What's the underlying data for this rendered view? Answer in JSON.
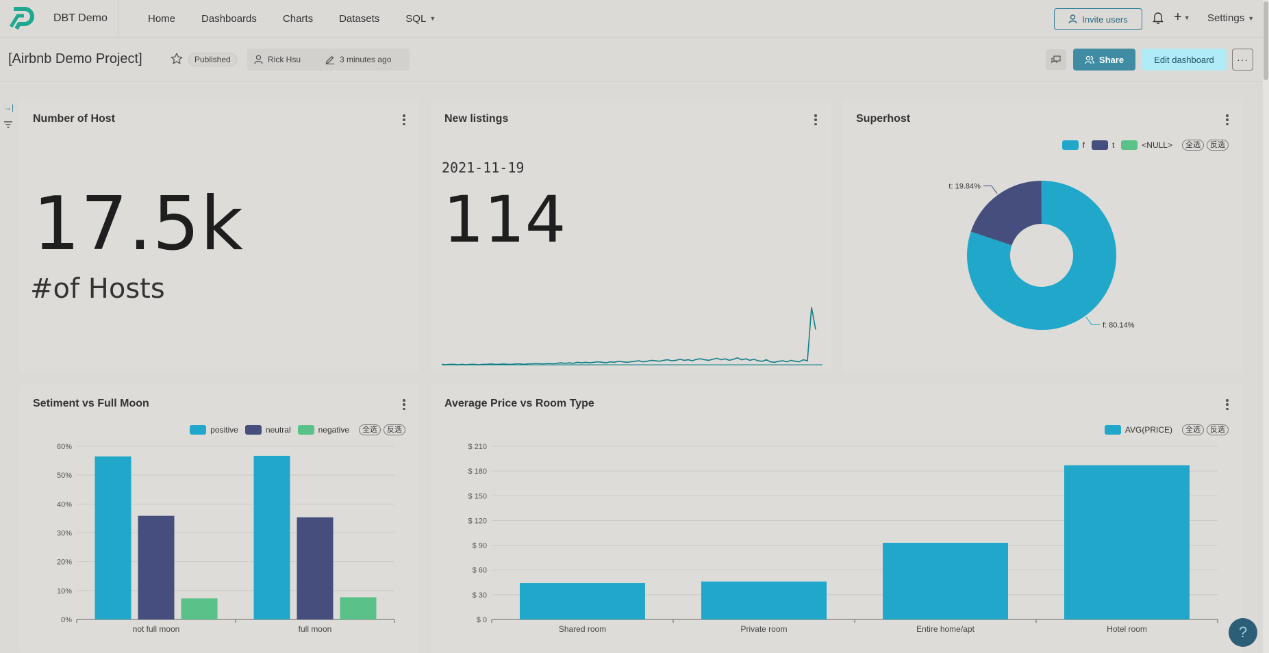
{
  "nav": {
    "brand": "DBT Demo",
    "items": [
      {
        "label": "Home",
        "has_caret": false
      },
      {
        "label": "Dashboards",
        "has_caret": false
      },
      {
        "label": "Charts",
        "has_caret": false
      },
      {
        "label": "Datasets",
        "has_caret": false
      },
      {
        "label": "SQL",
        "has_caret": true
      }
    ],
    "invite_label": "Invite users",
    "settings_label": "Settings",
    "plus_label": "+",
    "icons": {
      "bell": "bell-icon",
      "user": "user-icon"
    }
  },
  "dashboard": {
    "title": "[Airbnb Demo Project]",
    "status": "Published",
    "owner": "Rick Hsu",
    "edited": "3 minutes ago",
    "share_label": "Share",
    "edit_label": "Edit dashboard",
    "more_label": "···"
  },
  "colors": {
    "teal": "#20a7c9",
    "navy": "#454e7c",
    "green": "#5ac189",
    "line": "#0f7f87",
    "accent": "#3f8ca3"
  },
  "cards": {
    "hosts": {
      "title": "Number of Host",
      "value": "17.5k",
      "subtitle": "#of Hosts"
    },
    "listings": {
      "title": "New listings",
      "date": "2021-11-19",
      "value": "114",
      "trend": [
        1,
        0,
        1,
        1,
        0,
        1,
        0,
        1,
        1,
        0,
        1,
        1,
        2,
        1,
        1,
        2,
        1,
        1,
        2,
        2,
        1,
        2,
        2,
        3,
        2,
        2,
        3,
        2,
        3,
        4,
        3,
        4,
        3,
        5,
        4,
        5,
        4,
        5,
        6,
        5,
        4,
        6,
        5,
        7,
        6,
        5,
        6,
        7,
        8,
        6,
        7,
        9,
        8,
        7,
        9,
        10,
        8,
        9,
        11,
        9,
        10,
        8,
        11,
        12,
        10,
        9,
        11,
        13,
        10,
        12,
        9,
        11,
        14,
        10,
        12,
        9,
        11,
        8,
        7,
        10,
        6,
        5,
        7,
        8,
        6,
        9,
        7,
        6,
        10,
        8,
        114,
        70
      ]
    },
    "superhost": {
      "title": "Superhost",
      "filter_all": "全选",
      "filter_invert": "反选"
    },
    "sentiment": {
      "title": "Setiment vs Full Moon",
      "filter_all": "全选",
      "filter_invert": "反选"
    },
    "price": {
      "title": "Average Price vs Room Type",
      "filter_all": "全选",
      "filter_invert": "反选"
    }
  },
  "chart_data": [
    {
      "type": "pie",
      "title": "Superhost",
      "categories": [
        "f",
        "t",
        "<NULL>"
      ],
      "values": [
        80.14,
        19.84,
        0.02
      ],
      "labels": [
        "f: 80.14%",
        "t: 19.84%"
      ],
      "legend": "top-right"
    },
    {
      "type": "bar",
      "title": "Setiment vs Full Moon",
      "categories": [
        "not full moon",
        "full moon"
      ],
      "series": [
        {
          "name": "positive",
          "values": [
            56.5,
            56.7
          ]
        },
        {
          "name": "neutral",
          "values": [
            35.9,
            35.4
          ]
        },
        {
          "name": "negative",
          "values": [
            7.3,
            7.7
          ]
        }
      ],
      "yticks": [
        "0%",
        "10%",
        "20%",
        "30%",
        "40%",
        "50%",
        "60%"
      ],
      "ylim": [
        0,
        60
      ],
      "legend": "top-right"
    },
    {
      "type": "bar",
      "title": "Average Price vs Room Type",
      "categories": [
        "Shared room",
        "Private room",
        "Entire home/apt",
        "Hotel room"
      ],
      "series": [
        {
          "name": "AVG(PRICE)",
          "values": [
            44,
            46,
            93,
            187
          ]
        }
      ],
      "yticks": [
        "$ 0",
        "$ 30",
        "$ 60",
        "$ 90",
        "$ 120",
        "$ 150",
        "$ 180",
        "$ 210"
      ],
      "ylim": [
        0,
        210
      ],
      "legend": "top-right"
    }
  ]
}
